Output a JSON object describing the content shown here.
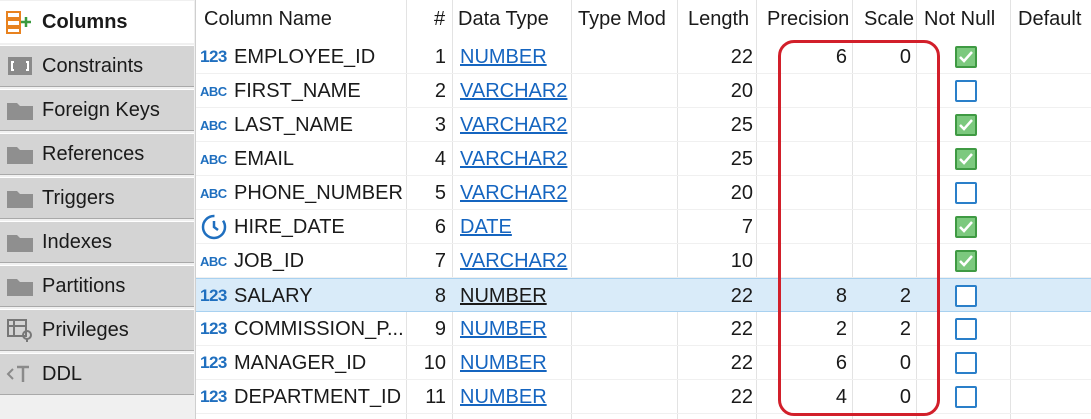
{
  "sidebar": {
    "items": [
      {
        "label": "Columns",
        "icon": "columns-icon",
        "active": true
      },
      {
        "label": "Constraints",
        "icon": "constraints-icon",
        "active": false
      },
      {
        "label": "Foreign Keys",
        "icon": "folder-icon",
        "active": false
      },
      {
        "label": "References",
        "icon": "folder-icon",
        "active": false
      },
      {
        "label": "Triggers",
        "icon": "folder-icon",
        "active": false
      },
      {
        "label": "Indexes",
        "icon": "folder-icon",
        "active": false
      },
      {
        "label": "Partitions",
        "icon": "folder-icon",
        "active": false
      },
      {
        "label": "Privileges",
        "icon": "privileges-icon",
        "active": false
      },
      {
        "label": "DDL",
        "icon": "ddl-icon",
        "active": false
      }
    ]
  },
  "grid": {
    "headers": {
      "column_name": "Column Name",
      "num": "#",
      "data_type": "Data Type",
      "type_mod": "Type Mod",
      "length": "Length",
      "precision": "Precision",
      "scale": "Scale",
      "not_null": "Not Null",
      "default": "Default"
    },
    "rows": [
      {
        "icon": "123",
        "name": "EMPLOYEE_ID",
        "num": "1",
        "type": "NUMBER",
        "length": "22",
        "precision": "6",
        "scale": "0",
        "not_null": true,
        "selected": false
      },
      {
        "icon": "ABC",
        "name": "FIRST_NAME",
        "num": "2",
        "type": "VARCHAR2",
        "length": "20",
        "precision": "",
        "scale": "",
        "not_null": false,
        "selected": false
      },
      {
        "icon": "ABC",
        "name": "LAST_NAME",
        "num": "3",
        "type": "VARCHAR2",
        "length": "25",
        "precision": "",
        "scale": "",
        "not_null": true,
        "selected": false
      },
      {
        "icon": "ABC",
        "name": "EMAIL",
        "num": "4",
        "type": "VARCHAR2",
        "length": "25",
        "precision": "",
        "scale": "",
        "not_null": true,
        "selected": false
      },
      {
        "icon": "ABC",
        "name": "PHONE_NUMBER",
        "num": "5",
        "type": "VARCHAR2",
        "length": "20",
        "precision": "",
        "scale": "",
        "not_null": false,
        "selected": false
      },
      {
        "icon": "clock",
        "name": "HIRE_DATE",
        "num": "6",
        "type": "DATE",
        "length": "7",
        "precision": "",
        "scale": "",
        "not_null": true,
        "selected": false
      },
      {
        "icon": "ABC",
        "name": "JOB_ID",
        "num": "7",
        "type": "VARCHAR2",
        "length": "10",
        "precision": "",
        "scale": "",
        "not_null": true,
        "selected": false
      },
      {
        "icon": "123",
        "name": "SALARY",
        "num": "8",
        "type": "NUMBER",
        "length": "22",
        "precision": "8",
        "scale": "2",
        "not_null": false,
        "selected": true
      },
      {
        "icon": "123",
        "name": "COMMISSION_P...",
        "num": "9",
        "type": "NUMBER",
        "length": "22",
        "precision": "2",
        "scale": "2",
        "not_null": false,
        "selected": false
      },
      {
        "icon": "123",
        "name": "MANAGER_ID",
        "num": "10",
        "type": "NUMBER",
        "length": "22",
        "precision": "6",
        "scale": "0",
        "not_null": false,
        "selected": false
      },
      {
        "icon": "123",
        "name": "DEPARTMENT_ID",
        "num": "11",
        "type": "NUMBER",
        "length": "22",
        "precision": "4",
        "scale": "0",
        "not_null": false,
        "selected": false
      }
    ]
  },
  "colors": {
    "link": "#1565c0",
    "selected_row": "#d9ebf9",
    "checkbox_checked": "#7cc97e",
    "highlight": "#d21f2a"
  }
}
